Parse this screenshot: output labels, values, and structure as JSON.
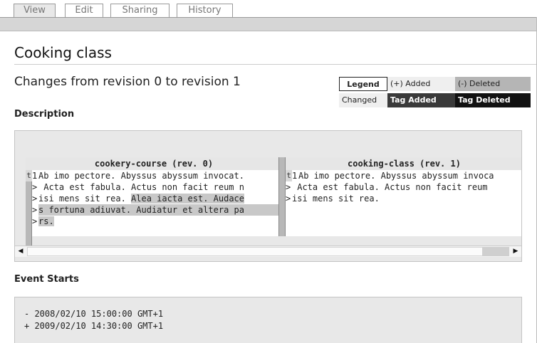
{
  "tabs": [
    {
      "label": "View"
    },
    {
      "label": "Edit"
    },
    {
      "label": "Sharing"
    },
    {
      "label": "History"
    }
  ],
  "page": {
    "title": "Cooking class",
    "subtitle": "Changes from revision 0 to revision 1"
  },
  "legend": {
    "title": "Legend",
    "added": "(+) Added",
    "deleted": "(-) Deleted",
    "changed": "Changed",
    "tag_added": "Tag Added",
    "tag_deleted": "Tag Deleted"
  },
  "description": {
    "heading": "Description",
    "left": {
      "header": "cookery-course (rev. 0)",
      "lines": [
        {
          "marker": "t",
          "num": "1",
          "text": "Ab imo pectore. Abyssus abyssum invocat."
        },
        {
          "marker": "",
          "num": ">",
          "text": " Acta est fabula. Actus non facit reum n"
        },
        {
          "marker": "",
          "num": ">",
          "text": "isi mens sit rea. ",
          "changed": "Alea iacta est. Audace"
        },
        {
          "marker": "",
          "num": ">",
          "changed_full": "s fortuna adiuvat. Audiatur et altera pa"
        },
        {
          "marker": "",
          "num": ">",
          "changed_full": "rs."
        }
      ]
    },
    "right": {
      "header": "cooking-class (rev. 1)",
      "lines": [
        {
          "marker": "t",
          "num": "1",
          "text": "Ab imo pectore. Abyssus abyssum invoca"
        },
        {
          "marker": "",
          "num": ">",
          "text": " Acta est fabula. Actus non facit reum"
        },
        {
          "marker": "",
          "num": ">",
          "text": "isi mens sit rea."
        }
      ]
    }
  },
  "event": {
    "heading": "Event Starts",
    "old": "- 2008/02/10 15:00:00 GMT+1",
    "new": "+ 2009/02/10 14:30:00 GMT+1"
  },
  "colors": {
    "band": "#d6d6d6",
    "box_bg": "#e8e8e8",
    "deleted_bg": "#b5b5b5",
    "tag_bg": "#1a1a1a"
  }
}
